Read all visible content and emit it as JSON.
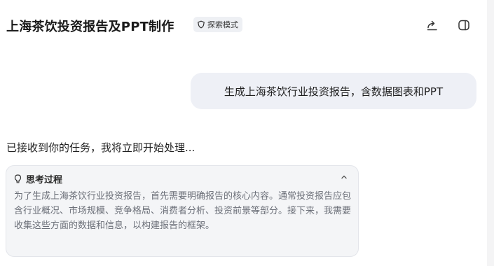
{
  "header": {
    "title": "上海茶饮投资报告及PPT制作",
    "mode_badge": "探索模式",
    "share_icon": "share-icon",
    "panel_icon": "side-panel-icon"
  },
  "messages": {
    "user": "生成上海茶饮行业投资报告，含数据图表和PPT",
    "assistant": "已接收到你的任务，我将立即开始处理..."
  },
  "thinking": {
    "title": "思考过程",
    "icon": "lightbulb-icon",
    "collapse_icon": "chevron-up-icon",
    "content": "为了生成上海茶饮行业投资报告，首先需要明确报告的核心内容。通常投资报告应包含行业概况、市场规模、竞争格局、消费者分析、投资前景等部分。接下来，我需要收集这些方面的数据和信息，以构建报告的框架。"
  }
}
